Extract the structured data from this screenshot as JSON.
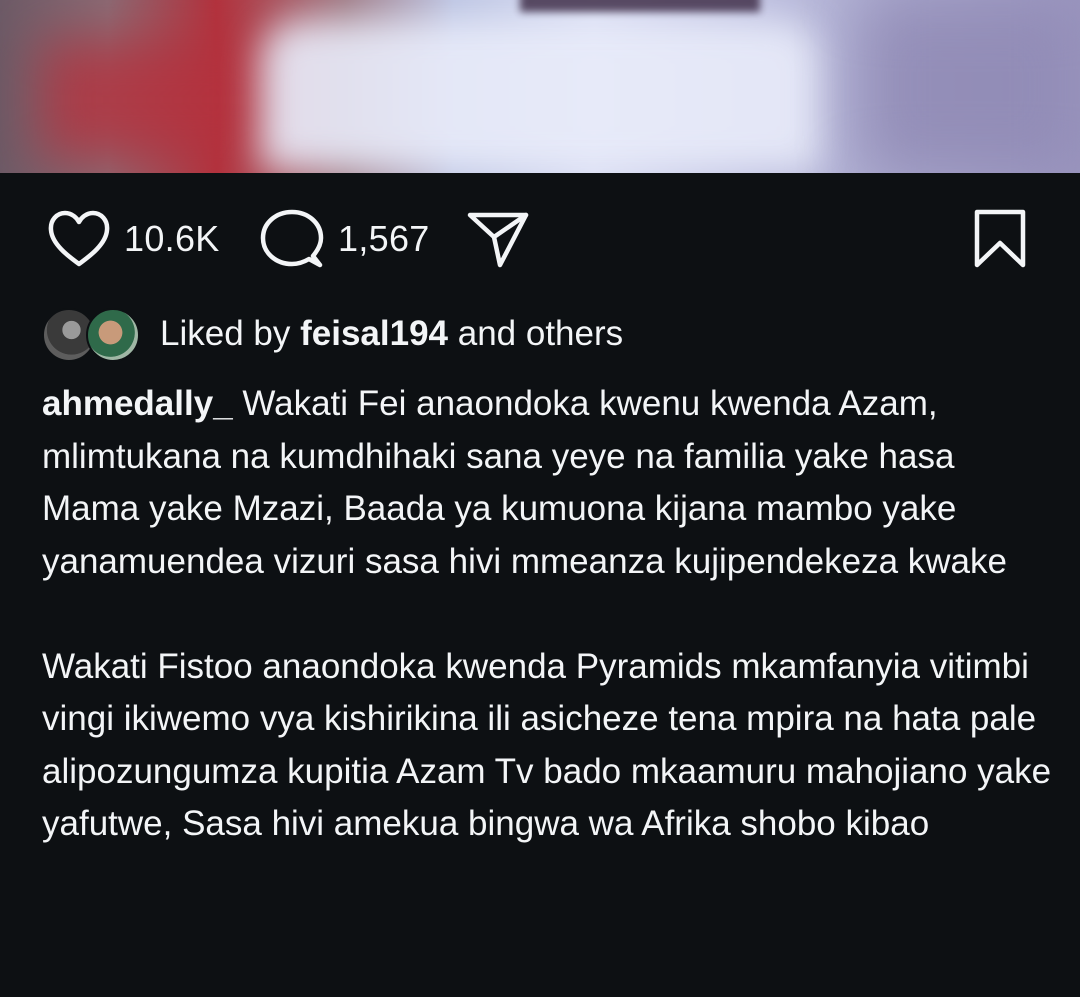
{
  "post": {
    "likes_count": "10.6K",
    "comments_count": "1,567",
    "liked_by": {
      "prefix": "Liked by",
      "user": "feisal194",
      "suffix": "and others"
    },
    "caption": {
      "username": "ahmedally_",
      "paragraph1": "Wakati Fei anaondoka kwenu kwenda Azam, mlimtukana na kumdhihaki sana yeye na familia yake hasa Mama yake Mzazi, Baada ya kumuona kijana mambo yake yanamuendea vizuri sasa hivi mmeanza kujipendekeza kwake",
      "paragraph2": "Wakati Fistoo anaondoka kwenda Pyramids mkamfanyia vitimbi vingi ikiwemo vya kishirikina ili asicheze tena mpira na hata pale alipozungumza kupitia Azam Tv bado mkaamuru mahojiano yake yafutwe, Sasa hivi amekua bingwa wa Afrika shobo kibao"
    }
  },
  "icons": {
    "like": "heart-icon",
    "comment": "comment-bubble-icon",
    "share": "send-paper-plane-icon",
    "save": "bookmark-icon"
  },
  "colors": {
    "background": "#0d1013",
    "text": "#f3f5f7"
  }
}
